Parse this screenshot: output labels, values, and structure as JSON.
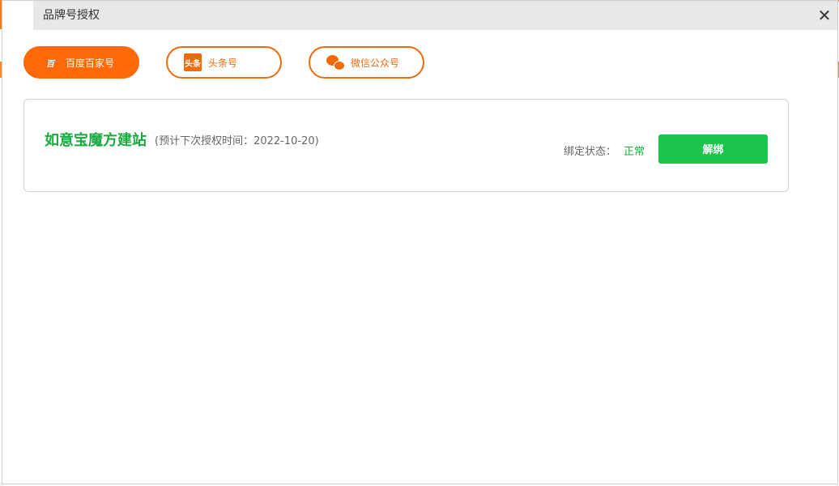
{
  "window": {
    "title": "品牌号授权",
    "close_glyph": "✕"
  },
  "tabs": [
    {
      "label": "百度百家号",
      "icon": "baidu-baijia-icon",
      "icon_glyph": "百",
      "active": true
    },
    {
      "label": "头条号",
      "icon": "toutiao-icon",
      "icon_glyph": "头条",
      "active": false
    },
    {
      "label": "微信公众号",
      "icon": "wechat-icon",
      "active": false
    }
  ],
  "account": {
    "name": "如意宝魔方建站",
    "note": "(预计下次授权时间：2022-10-20)",
    "status_label": "绑定状态：",
    "status_value": "正常",
    "unbind_label": "解绑"
  },
  "colors": {
    "accent": "#fe6a0a",
    "success": "#1aaa40",
    "button_green": "#1bc44a"
  }
}
